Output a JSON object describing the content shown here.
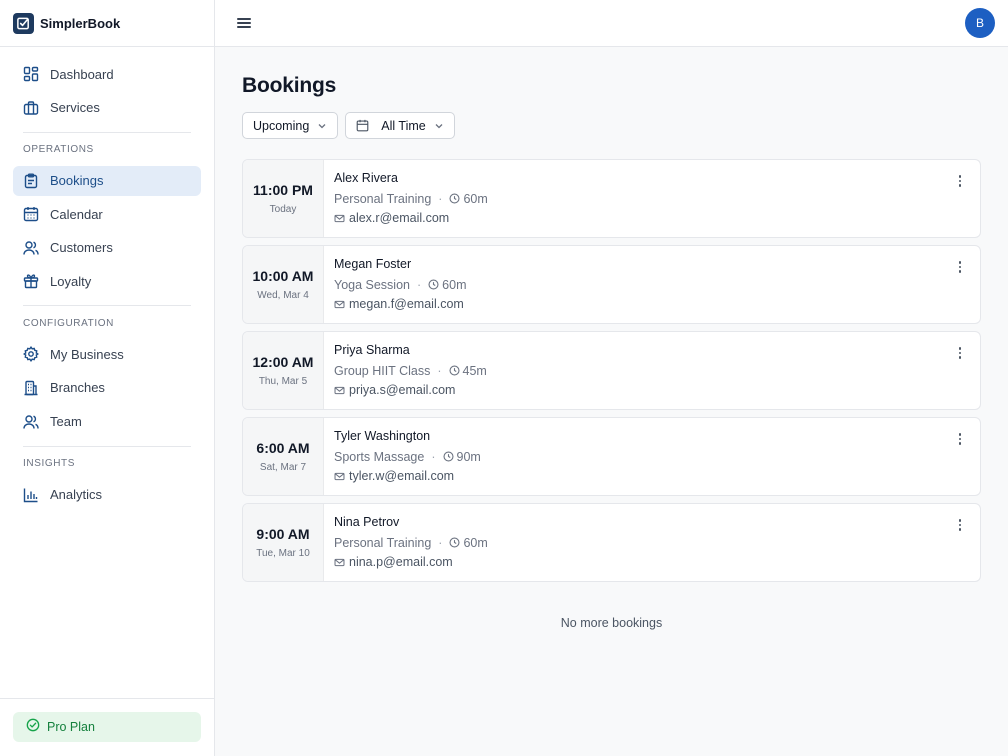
{
  "brand": {
    "name": "SimplerBook"
  },
  "sidebar": {
    "top_items": [
      {
        "label": "Dashboard",
        "icon": "dashboard-icon"
      },
      {
        "label": "Services",
        "icon": "briefcase-icon"
      }
    ],
    "sections": [
      {
        "title": "OPERATIONS",
        "items": [
          {
            "label": "Bookings",
            "icon": "clipboard-icon",
            "active": true
          },
          {
            "label": "Calendar",
            "icon": "calendar-icon"
          },
          {
            "label": "Customers",
            "icon": "users-icon"
          },
          {
            "label": "Loyalty",
            "icon": "gift-icon"
          }
        ]
      },
      {
        "title": "CONFIGURATION",
        "items": [
          {
            "label": "My Business",
            "icon": "gear-icon"
          },
          {
            "label": "Branches",
            "icon": "building-icon"
          },
          {
            "label": "Team",
            "icon": "users-icon"
          }
        ]
      },
      {
        "title": "INSIGHTS",
        "items": [
          {
            "label": "Analytics",
            "icon": "bar-chart-icon"
          }
        ]
      }
    ],
    "plan_label": "Pro Plan"
  },
  "topbar": {
    "avatar_initial": "B"
  },
  "page": {
    "title": "Bookings",
    "filters": {
      "status": "Upcoming",
      "range": "All Time"
    },
    "bookings": [
      {
        "time": "11:00 PM",
        "date": "Today",
        "customer": "Alex Rivera",
        "service": "Personal Training",
        "duration": "60m",
        "email": "alex.r@email.com"
      },
      {
        "time": "10:00 AM",
        "date": "Wed, Mar 4",
        "customer": "Megan Foster",
        "service": "Yoga Session",
        "duration": "60m",
        "email": "megan.f@email.com"
      },
      {
        "time": "12:00 AM",
        "date": "Thu, Mar 5",
        "customer": "Priya Sharma",
        "service": "Group HIIT Class",
        "duration": "45m",
        "email": "priya.s@email.com"
      },
      {
        "time": "6:00 AM",
        "date": "Sat, Mar 7",
        "customer": "Tyler Washington",
        "service": "Sports Massage",
        "duration": "90m",
        "email": "tyler.w@email.com"
      },
      {
        "time": "9:00 AM",
        "date": "Tue, Mar 10",
        "customer": "Nina Petrov",
        "service": "Personal Training",
        "duration": "60m",
        "email": "nina.p@email.com"
      }
    ],
    "empty_note": "No more bookings"
  },
  "colors": {
    "accent": "#1d4e89",
    "active_bg": "#e3ecf8",
    "avatar": "#1d5fc2",
    "plan_bg": "#e6f6ea",
    "plan_text": "#15803d"
  }
}
